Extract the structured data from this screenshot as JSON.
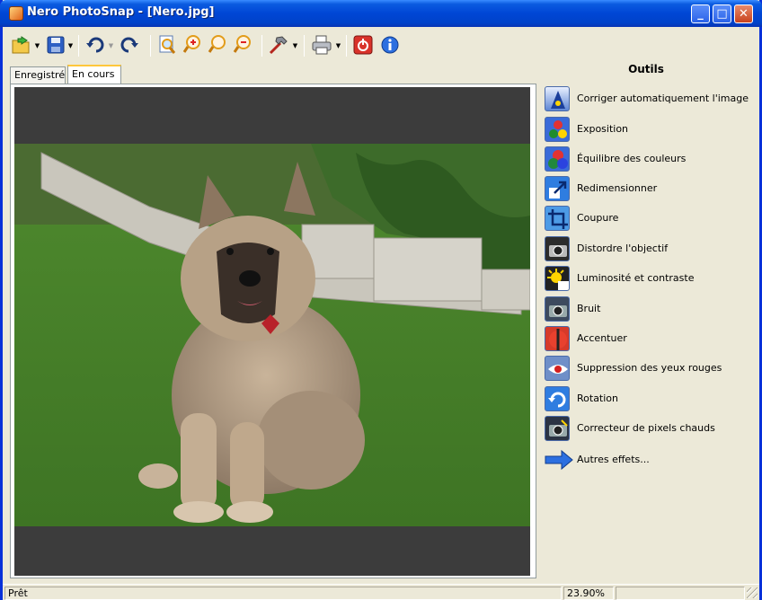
{
  "window": {
    "title": "Nero PhotoSnap - [Nero.jpg]"
  },
  "toolbar": {
    "items": [
      {
        "name": "open-icon"
      },
      {
        "name": "save-icon"
      },
      {
        "name": "undo-icon"
      },
      {
        "name": "redo-icon"
      },
      {
        "name": "zoom-fit-icon"
      },
      {
        "name": "zoom-in-icon"
      },
      {
        "name": "zoom-actual-icon"
      },
      {
        "name": "zoom-out-icon"
      },
      {
        "name": "tools-hammer-icon"
      },
      {
        "name": "print-icon"
      },
      {
        "name": "power-icon"
      },
      {
        "name": "info-icon"
      }
    ]
  },
  "tabs": [
    {
      "label": "Enregistré"
    },
    {
      "label": "En cours"
    }
  ],
  "tools_panel": {
    "title": "Outils",
    "items": [
      {
        "label": "Corriger automatiquement l'image",
        "icon": "auto-fix-icon"
      },
      {
        "label": "Exposition",
        "icon": "exposure-icon"
      },
      {
        "label": "Équilibre des couleurs",
        "icon": "color-balance-icon"
      },
      {
        "label": "Redimensionner",
        "icon": "resize-icon"
      },
      {
        "label": "Coupure",
        "icon": "crop-icon"
      },
      {
        "label": "Distordre l'objectif",
        "icon": "lens-distort-icon"
      },
      {
        "label": "Luminosité et contraste",
        "icon": "brightness-icon"
      },
      {
        "label": "Bruit",
        "icon": "noise-icon"
      },
      {
        "label": "Accentuer",
        "icon": "sharpen-icon"
      },
      {
        "label": "Suppression des yeux rouges",
        "icon": "red-eye-icon"
      },
      {
        "label": "Rotation",
        "icon": "rotation-icon"
      },
      {
        "label": "Correcteur de pixels chauds",
        "icon": "hot-pixel-icon"
      },
      {
        "label": "Autres effets...",
        "icon": "arrow-right-icon"
      }
    ]
  },
  "status": {
    "left": "Prêt",
    "zoom": "23.90%"
  },
  "colors": {
    "title_bar": "#0046d5",
    "canvas_bg": "#3c3c3c",
    "tab_highlight": "#ffc73c"
  }
}
